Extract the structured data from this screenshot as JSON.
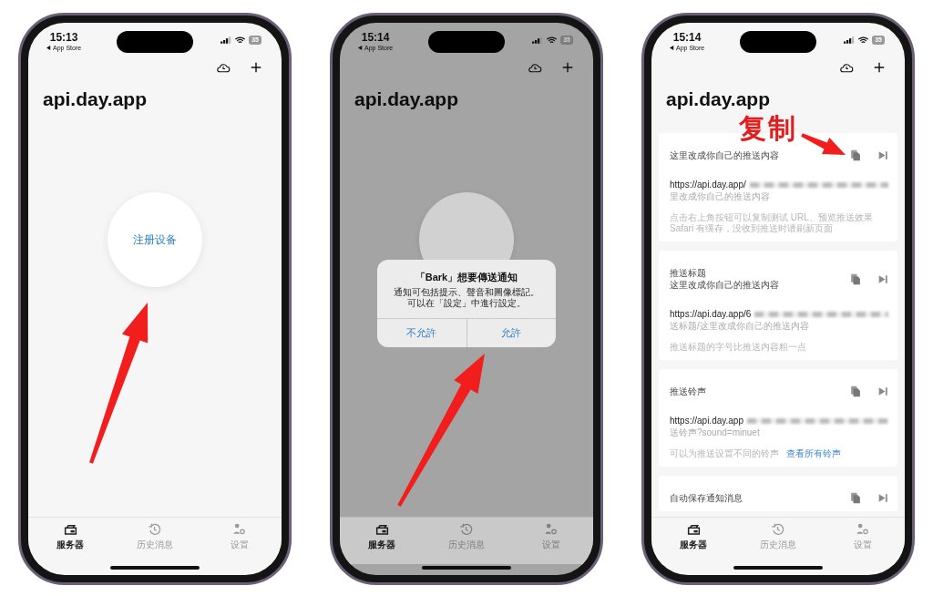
{
  "phones": [
    {
      "status": {
        "time": "15:13",
        "back": "App Store",
        "battery": "35"
      },
      "title": "api.day.app",
      "dimmed": false,
      "screen": {
        "kind": "register",
        "button": "注册设备"
      },
      "tabs": [
        {
          "label": "服务器",
          "selected": true
        },
        {
          "label": "历史消息",
          "selected": false
        },
        {
          "label": "设置",
          "selected": false
        }
      ]
    },
    {
      "status": {
        "time": "15:14",
        "back": "App Store",
        "battery": "35"
      },
      "title": "api.day.app",
      "dimmed": true,
      "screen": {
        "kind": "register"
      },
      "alert": {
        "title": "「Bark」想要傳送通知",
        "message": [
          "通知可包括提示、聲音和圖像標記。",
          "可以在「設定」中進行設定。"
        ],
        "buttons": [
          "不允許",
          "允許"
        ]
      },
      "tabs": [
        {
          "label": "服务器",
          "selected": true
        },
        {
          "label": "历史消息",
          "selected": false
        },
        {
          "label": "设置",
          "selected": false
        }
      ]
    },
    {
      "status": {
        "time": "15:14",
        "back": "App Store",
        "battery": "35"
      },
      "title": "api.day.app",
      "dimmed": false,
      "annotation": "复制",
      "screen": {
        "kind": "list",
        "cards": [
          {
            "title": [
              "这里改成你自己的推送内容"
            ],
            "url": "https://api.day.app/",
            "body": "里改成你自己的推送内容",
            "hints": [
              "点击右上角按钮可以复制测试 URL、预览推送效果",
              "Safari 有缓存，没收到推送时请刷新页面"
            ]
          },
          {
            "title": [
              "推送标题",
              "这里改成你自己的推送内容"
            ],
            "url": "https://api.day.app/6",
            "body": "送标题/这里改成你自己的推送内容",
            "hints": [
              "推送标题的字号比推送内容粗一点"
            ]
          },
          {
            "title": [
              "推送铃声"
            ],
            "url": "https://api.day.app",
            "body": "送铃声?sound=minuet",
            "hints": [
              "可以为推送设置不同的铃声"
            ],
            "link": "查看所有铃声"
          },
          {
            "title": [
              "自动保存通知消息"
            ]
          }
        ]
      },
      "tabs": [
        {
          "label": "服务器",
          "selected": true
        },
        {
          "label": "历史消息",
          "selected": false
        },
        {
          "label": "设置",
          "selected": false
        }
      ]
    }
  ]
}
